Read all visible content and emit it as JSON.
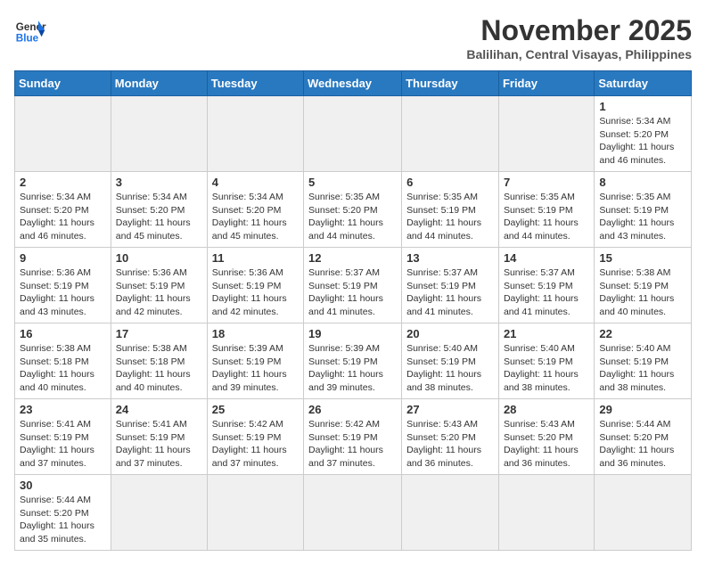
{
  "logo": {
    "text_general": "General",
    "text_blue": "Blue"
  },
  "header": {
    "month": "November 2025",
    "location": "Balilihan, Central Visayas, Philippines"
  },
  "weekdays": [
    "Sunday",
    "Monday",
    "Tuesday",
    "Wednesday",
    "Thursday",
    "Friday",
    "Saturday"
  ],
  "days": [
    {
      "num": "",
      "info": ""
    },
    {
      "num": "",
      "info": ""
    },
    {
      "num": "",
      "info": ""
    },
    {
      "num": "",
      "info": ""
    },
    {
      "num": "",
      "info": ""
    },
    {
      "num": "",
      "info": ""
    },
    {
      "num": "1",
      "info": "Sunrise: 5:34 AM\nSunset: 5:20 PM\nDaylight: 11 hours\nand 46 minutes."
    }
  ],
  "week2": [
    {
      "num": "2",
      "info": "Sunrise: 5:34 AM\nSunset: 5:20 PM\nDaylight: 11 hours\nand 46 minutes."
    },
    {
      "num": "3",
      "info": "Sunrise: 5:34 AM\nSunset: 5:20 PM\nDaylight: 11 hours\nand 45 minutes."
    },
    {
      "num": "4",
      "info": "Sunrise: 5:34 AM\nSunset: 5:20 PM\nDaylight: 11 hours\nand 45 minutes."
    },
    {
      "num": "5",
      "info": "Sunrise: 5:35 AM\nSunset: 5:20 PM\nDaylight: 11 hours\nand 44 minutes."
    },
    {
      "num": "6",
      "info": "Sunrise: 5:35 AM\nSunset: 5:19 PM\nDaylight: 11 hours\nand 44 minutes."
    },
    {
      "num": "7",
      "info": "Sunrise: 5:35 AM\nSunset: 5:19 PM\nDaylight: 11 hours\nand 44 minutes."
    },
    {
      "num": "8",
      "info": "Sunrise: 5:35 AM\nSunset: 5:19 PM\nDaylight: 11 hours\nand 43 minutes."
    }
  ],
  "week3": [
    {
      "num": "9",
      "info": "Sunrise: 5:36 AM\nSunset: 5:19 PM\nDaylight: 11 hours\nand 43 minutes."
    },
    {
      "num": "10",
      "info": "Sunrise: 5:36 AM\nSunset: 5:19 PM\nDaylight: 11 hours\nand 42 minutes."
    },
    {
      "num": "11",
      "info": "Sunrise: 5:36 AM\nSunset: 5:19 PM\nDaylight: 11 hours\nand 42 minutes."
    },
    {
      "num": "12",
      "info": "Sunrise: 5:37 AM\nSunset: 5:19 PM\nDaylight: 11 hours\nand 41 minutes."
    },
    {
      "num": "13",
      "info": "Sunrise: 5:37 AM\nSunset: 5:19 PM\nDaylight: 11 hours\nand 41 minutes."
    },
    {
      "num": "14",
      "info": "Sunrise: 5:37 AM\nSunset: 5:19 PM\nDaylight: 11 hours\nand 41 minutes."
    },
    {
      "num": "15",
      "info": "Sunrise: 5:38 AM\nSunset: 5:19 PM\nDaylight: 11 hours\nand 40 minutes."
    }
  ],
  "week4": [
    {
      "num": "16",
      "info": "Sunrise: 5:38 AM\nSunset: 5:18 PM\nDaylight: 11 hours\nand 40 minutes."
    },
    {
      "num": "17",
      "info": "Sunrise: 5:38 AM\nSunset: 5:18 PM\nDaylight: 11 hours\nand 40 minutes."
    },
    {
      "num": "18",
      "info": "Sunrise: 5:39 AM\nSunset: 5:19 PM\nDaylight: 11 hours\nand 39 minutes."
    },
    {
      "num": "19",
      "info": "Sunrise: 5:39 AM\nSunset: 5:19 PM\nDaylight: 11 hours\nand 39 minutes."
    },
    {
      "num": "20",
      "info": "Sunrise: 5:40 AM\nSunset: 5:19 PM\nDaylight: 11 hours\nand 38 minutes."
    },
    {
      "num": "21",
      "info": "Sunrise: 5:40 AM\nSunset: 5:19 PM\nDaylight: 11 hours\nand 38 minutes."
    },
    {
      "num": "22",
      "info": "Sunrise: 5:40 AM\nSunset: 5:19 PM\nDaylight: 11 hours\nand 38 minutes."
    }
  ],
  "week5": [
    {
      "num": "23",
      "info": "Sunrise: 5:41 AM\nSunset: 5:19 PM\nDaylight: 11 hours\nand 37 minutes."
    },
    {
      "num": "24",
      "info": "Sunrise: 5:41 AM\nSunset: 5:19 PM\nDaylight: 11 hours\nand 37 minutes."
    },
    {
      "num": "25",
      "info": "Sunrise: 5:42 AM\nSunset: 5:19 PM\nDaylight: 11 hours\nand 37 minutes."
    },
    {
      "num": "26",
      "info": "Sunrise: 5:42 AM\nSunset: 5:19 PM\nDaylight: 11 hours\nand 37 minutes."
    },
    {
      "num": "27",
      "info": "Sunrise: 5:43 AM\nSunset: 5:20 PM\nDaylight: 11 hours\nand 36 minutes."
    },
    {
      "num": "28",
      "info": "Sunrise: 5:43 AM\nSunset: 5:20 PM\nDaylight: 11 hours\nand 36 minutes."
    },
    {
      "num": "29",
      "info": "Sunrise: 5:44 AM\nSunset: 5:20 PM\nDaylight: 11 hours\nand 36 minutes."
    }
  ],
  "week6": [
    {
      "num": "30",
      "info": "Sunrise: 5:44 AM\nSunset: 5:20 PM\nDaylight: 11 hours\nand 35 minutes."
    },
    {
      "num": "",
      "info": ""
    },
    {
      "num": "",
      "info": ""
    },
    {
      "num": "",
      "info": ""
    },
    {
      "num": "",
      "info": ""
    },
    {
      "num": "",
      "info": ""
    },
    {
      "num": "",
      "info": ""
    }
  ]
}
